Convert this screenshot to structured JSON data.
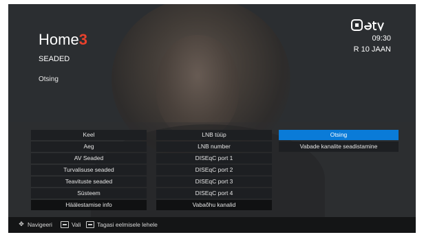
{
  "header": {
    "logo_text": "Home",
    "logo_mark": "3",
    "title": "SEADED",
    "subtitle": "Otsing",
    "brand": "etv",
    "time": "09:30",
    "date": "R 10 JAAN"
  },
  "menu": {
    "col1": [
      "Keel",
      "Aeg",
      "AV Seaded",
      "Turvalisuse seaded",
      "Teavituste seaded",
      "Süsteem",
      "Häälestamise info"
    ],
    "col2": [
      "LNB tüüp",
      "LNB number",
      "DISEqC port 1",
      "DISEqC port 2",
      "DISEqC port 3",
      "DISEqC port 4",
      "Vabaõhu kanalid"
    ],
    "col3": [
      "Otsing",
      "Vabade kanalite seadistamine"
    ]
  },
  "footer": {
    "navigate": "Navigeeri",
    "select": "Vali",
    "back": "Tagasi eelmisele lehele"
  },
  "colors": {
    "accent": "#0a7bd8",
    "logo_mark": "#e8412c"
  }
}
